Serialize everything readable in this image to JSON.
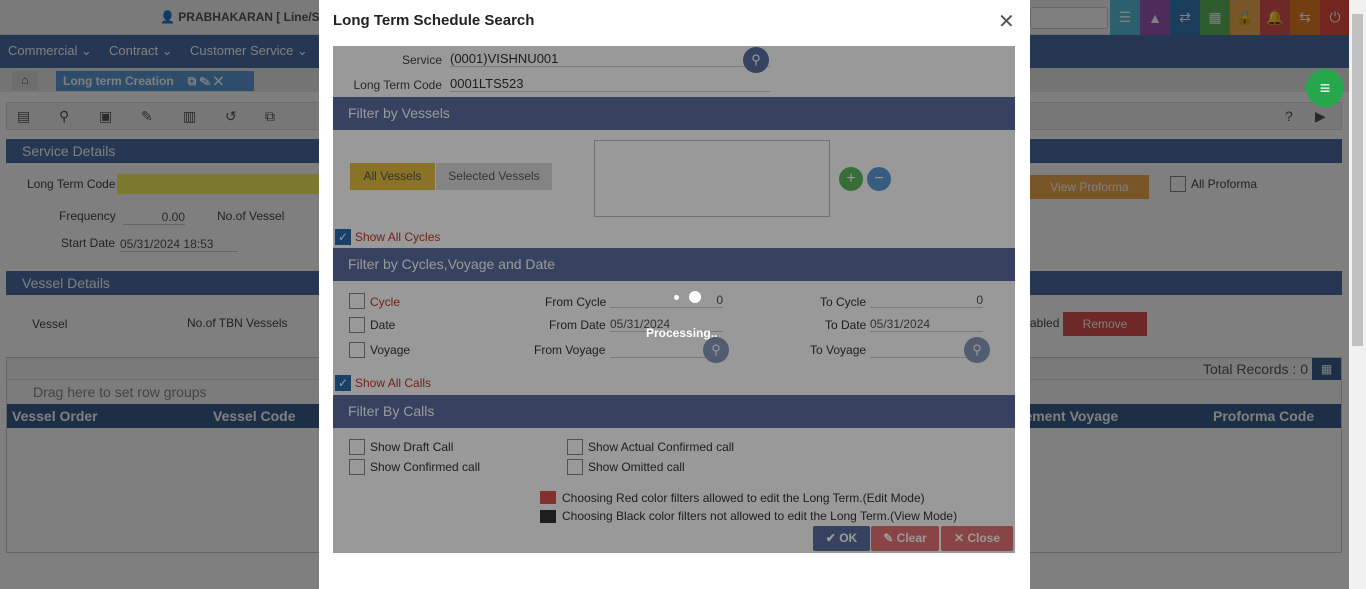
{
  "topbar": {
    "user": "PRABHAKARAN [ Line/SV",
    "notif_count": "0"
  },
  "menu": {
    "items": [
      "Commercial ⌄",
      "Contract ⌄",
      "Customer Service ⌄"
    ]
  },
  "tabs": {
    "active": "Long term Creation"
  },
  "service_details": {
    "header": "Service Details",
    "long_term_code_label": "Long Term Code",
    "frequency_label": "Frequency",
    "frequency_value": "0.00",
    "no_of_vessel_label": "No.of Vessel",
    "start_date_label": "Start Date",
    "start_date_value": "05/31/2024 18:53",
    "view_proforma": "View Proforma",
    "all_proforma": "All Proforma"
  },
  "vessel_details": {
    "header": "Vessel Details",
    "vessel_radio": "Vessel",
    "tbn_radio": "No.of TBN Vessels",
    "enabled_text": "abled",
    "remove_btn": "Remove",
    "total_records": "Total Records : 0",
    "group_hint": "Drag here to set row groups",
    "columns": [
      "Vessel Order",
      "Vessel Code",
      "rement Voyage",
      "Proforma Code"
    ],
    "columns_side": "Columns"
  },
  "modal": {
    "title": "Long Term Schedule Search",
    "service_label": "Service",
    "service_value": "(0001)VISHNU001",
    "long_term_code_label": "Long Term Code",
    "long_term_code_value": "0001LTS523",
    "filter_vessels": "Filter by Vessels",
    "all_vessels": "All Vessels",
    "selected_vessels": "Selected Vessels",
    "show_all_cycles": "Show All Cycles",
    "filter_cycles": "Filter by Cycles,Voyage and Date",
    "cycle": "Cycle",
    "date": "Date",
    "voyage": "Voyage",
    "from_cycle_label": "From Cycle",
    "from_cycle_value": "0",
    "to_cycle_label": "To Cycle",
    "to_cycle_value": "0",
    "from_date_label": "From Date",
    "from_date_value": "05/31/2024",
    "to_date_label": "To Date",
    "to_date_value": "05/31/2024",
    "from_voyage_label": "From Voyage",
    "to_voyage_label": "To Voyage",
    "show_all_calls": "Show All Calls",
    "filter_calls": "Filter By Calls",
    "show_draft_call": "Show Draft Call",
    "show_actual_confirmed_call": "Show Actual Confirmed call",
    "show_confirmed_call": "Show Confirmed call",
    "show_omitted_call": "Show Omitted call",
    "legend_red": "Choosing Red color filters allowed to edit the Long Term.(Edit Mode)",
    "legend_black": "Choosing Black color filters not allowed to edit the Long Term.(View Mode)",
    "ok": "OK",
    "clear": "Clear",
    "close": "Close",
    "processing": "Processing.."
  },
  "colors": {
    "accent": "#4a6fa5",
    "header_band": "#5a6e9e",
    "red": "#c0392b",
    "ok_btn": "#5a6e9e",
    "clear_btn": "#e57373",
    "close_btn": "#e57373"
  }
}
